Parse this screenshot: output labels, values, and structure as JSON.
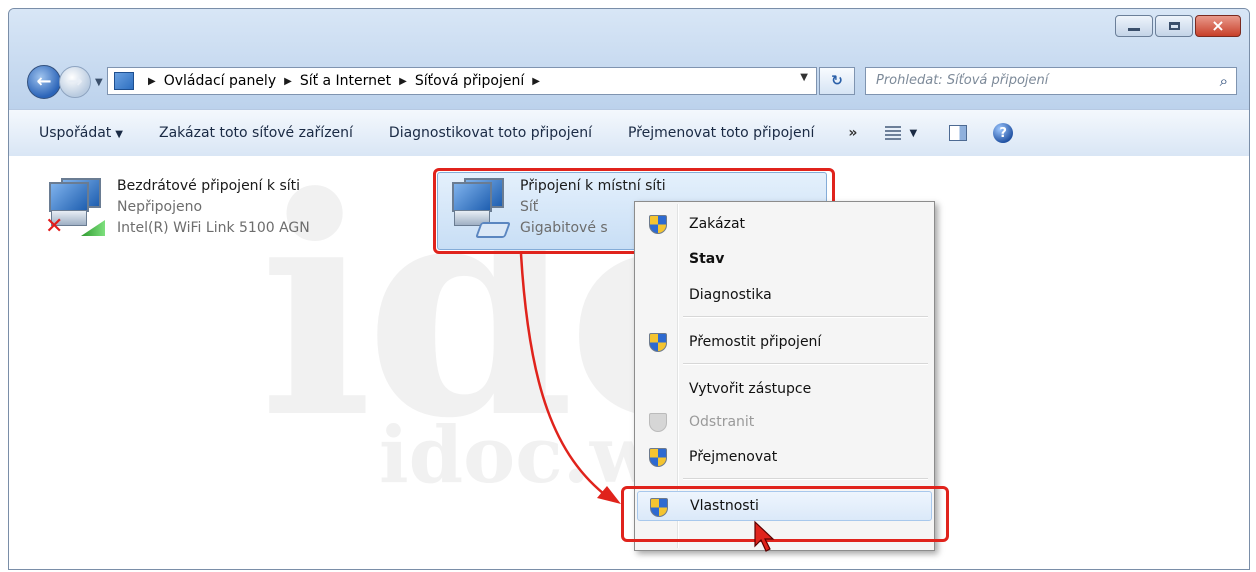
{
  "window": {
    "controls": [
      "minimize",
      "maximize",
      "close"
    ]
  },
  "nav": {
    "address_path": [
      "Ovládací panely",
      "Síť a Internet",
      "Síťová připojení"
    ],
    "search_placeholder": "Prohledat: Síťová připojení",
    "icons": {
      "back": "back-arrow-icon",
      "forward": "forward-arrow-icon",
      "refresh": "refresh-icon",
      "search": "search-icon"
    }
  },
  "toolbar": {
    "organize": "Uspořádat",
    "disable_device": "Zakázat toto síťové zařízení",
    "diagnose": "Diagnostikovat toto připojení",
    "rename": "Přejmenovat toto připojení",
    "more": "»"
  },
  "connections": [
    {
      "name": "Bezdrátové připojení k síti",
      "status": "Nepřipojeno",
      "device": "Intel(R) WiFi Link 5100 AGN"
    },
    {
      "name": "Připojení k místní síti",
      "status": "Síť",
      "device": "Gigabitové s"
    }
  ],
  "context_menu": {
    "items": [
      {
        "label": "Zakázat",
        "shield": true
      },
      {
        "label": "Stav",
        "bold": true
      },
      {
        "label": "Diagnostika"
      },
      {
        "label": "Přemostit připojení",
        "shield": true
      },
      {
        "label": "Vytvořit zástupce"
      },
      {
        "label": "Odstranit",
        "shield": true,
        "disabled": true
      },
      {
        "label": "Přejmenovat",
        "shield": true
      },
      {
        "label": "Vlastnosti",
        "shield": true,
        "highlighted": true
      }
    ]
  },
  "watermark": {
    "big": "idoc",
    "small": "idoc.web.cz"
  },
  "colors": {
    "annotation_red": "#e0231c",
    "selection_blue": "#c8def5",
    "title_blue": "#c8daf0"
  }
}
